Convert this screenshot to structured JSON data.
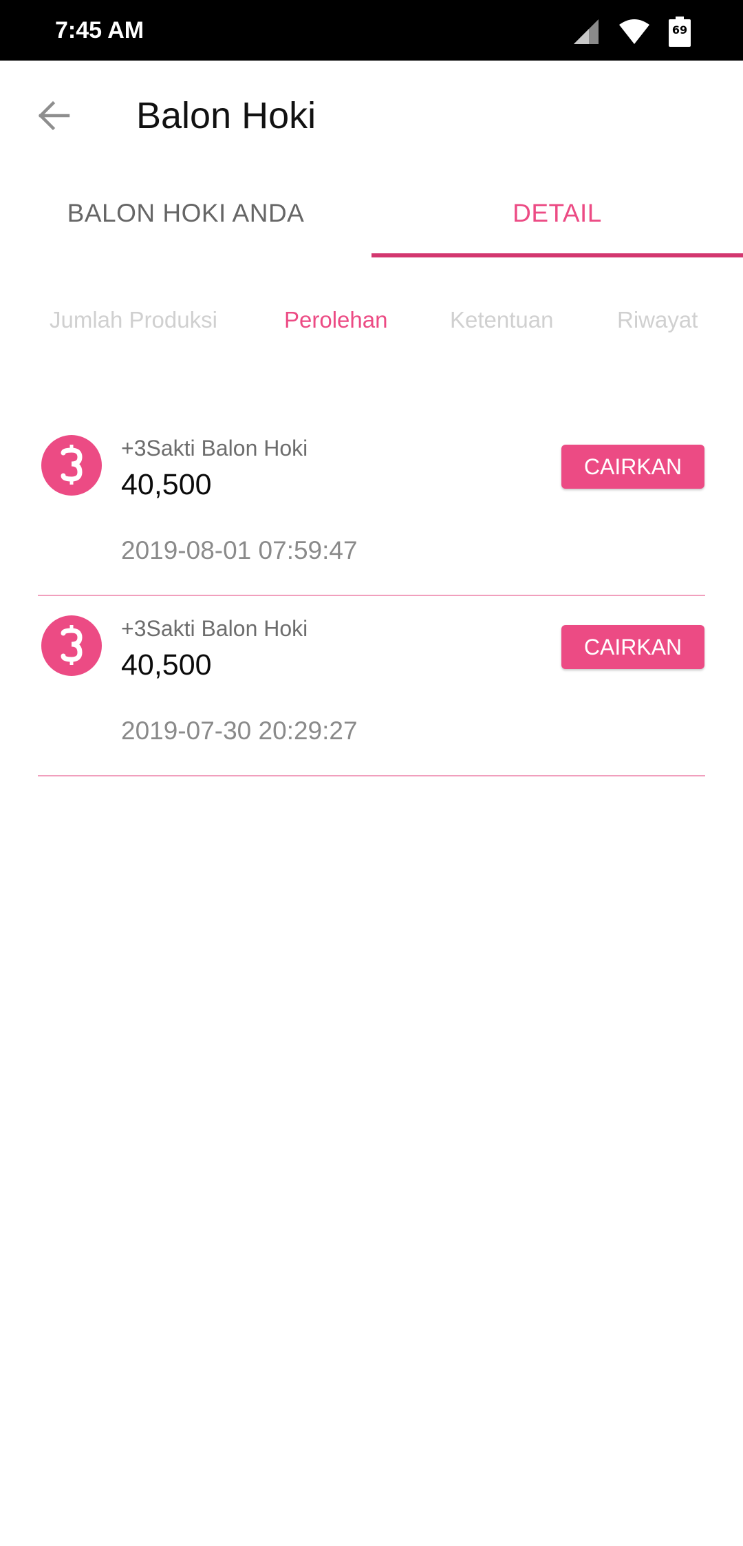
{
  "status_bar": {
    "time": "7:45 AM",
    "battery_level": "69"
  },
  "header": {
    "title": "Balon Hoki",
    "back_icon": "arrow-left-icon"
  },
  "tabs": [
    {
      "label": "BALON HOKI ANDA",
      "selected": false
    },
    {
      "label": "DETAIL",
      "selected": true
    }
  ],
  "subtabs": [
    {
      "label": "Jumlah Produksi",
      "selected": false
    },
    {
      "label": "Perolehan",
      "selected": true
    },
    {
      "label": "Ketentuan",
      "selected": false
    },
    {
      "label": "Riwayat",
      "selected": false
    }
  ],
  "items": [
    {
      "title": "+3Sakti Balon Hoki",
      "amount": "40,500",
      "date": "2019-08-01 07:59:47",
      "button_label": "CAIRKAN",
      "icon": "coin-icon"
    },
    {
      "title": "+3Sakti Balon Hoki",
      "amount": "40,500",
      "date": "2019-07-30 20:29:27",
      "button_label": "CAIRKAN",
      "icon": "coin-icon"
    }
  ],
  "colors": {
    "accent": "#ec4b84",
    "tab_indicator": "#d3376f",
    "divider": "#f19fbd"
  }
}
